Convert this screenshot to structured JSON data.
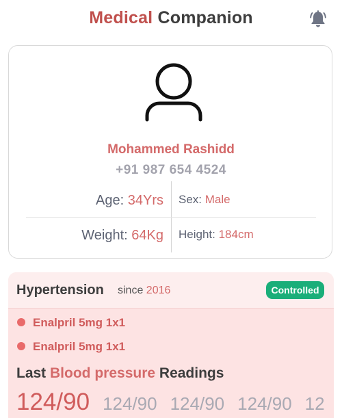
{
  "header": {
    "title_accent": "Medical",
    "title_rest": "Companion",
    "bell_icon": "bell-icon"
  },
  "profile": {
    "avatar_icon": "user-icon",
    "name": "Mohammed Rashidd",
    "phone": "+91 987 654 4524",
    "age_label": "Age: ",
    "age_value": "34Yrs",
    "sex_label": "Sex: ",
    "sex_value": "Male",
    "weight_label": "Weight: ",
    "weight_value": "64Kg",
    "height_label": "Height: ",
    "height_value": "184cm"
  },
  "condition": {
    "name": "Hypertension",
    "since_label": "since ",
    "since_year": "2016",
    "status": "Controlled",
    "status_color": "#1aae79",
    "medications": [
      {
        "label": "Enalpril 5mg 1x1"
      },
      {
        "label": "Enalpril 5mg 1x1"
      }
    ],
    "readings_title_1": "Last ",
    "readings_title_2": "Blood pressure",
    "readings_title_3": " Readings",
    "readings": [
      "124/90",
      "124/90",
      "124/90",
      "124/90",
      "12"
    ]
  },
  "colors": {
    "accent": "#c0504d",
    "value": "#d46a6a",
    "card_bg": "#fde3e3"
  }
}
